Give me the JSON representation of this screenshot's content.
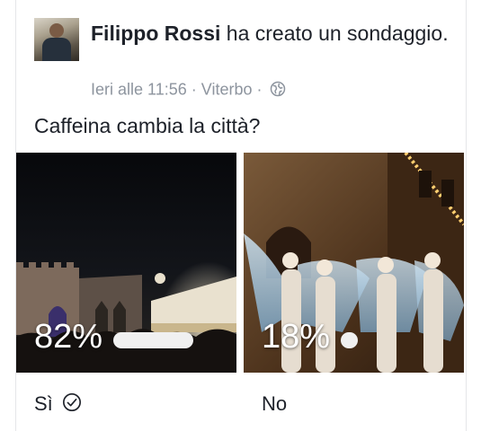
{
  "post": {
    "author": "Filippo Rossi",
    "action": " ha creato un sondaggio.",
    "timestamp": "Ieri alle 11:56",
    "location": "Viterbo",
    "separator": "·",
    "privacy_icon": "globe-icon"
  },
  "poll": {
    "question": "Caffeina cambia la città?",
    "options": [
      {
        "label": "Sì",
        "percent_text": "82%",
        "fraction": 0.82,
        "selected": true,
        "selected_icon": "check-circle-icon"
      },
      {
        "label": "No",
        "percent_text": "18%",
        "fraction": 0.18,
        "selected": false
      }
    ]
  },
  "colors": {
    "text": "#1d2129",
    "meta": "#8d949e",
    "bar": "#f0f0f0"
  }
}
